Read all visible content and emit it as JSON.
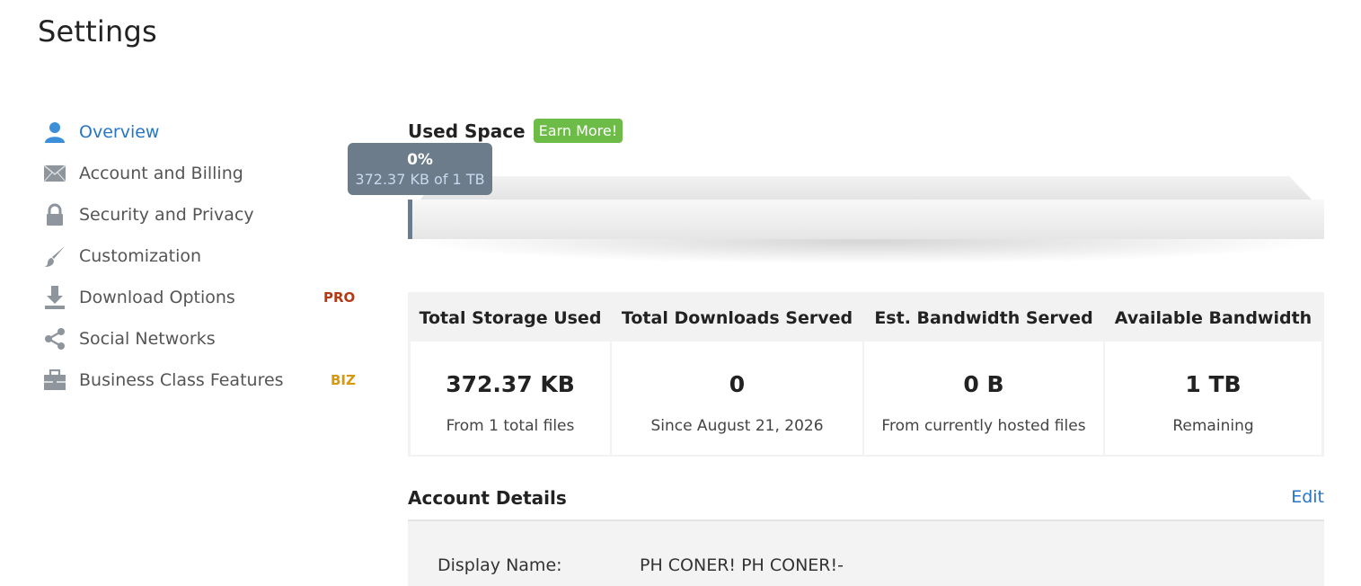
{
  "page": {
    "title": "Settings"
  },
  "sidebar": {
    "items": [
      {
        "label": "Overview",
        "icon": "user-icon",
        "active": true,
        "badge": ""
      },
      {
        "label": "Account and Billing",
        "icon": "envelope-icon",
        "active": false,
        "badge": ""
      },
      {
        "label": "Security and Privacy",
        "icon": "lock-icon",
        "active": false,
        "badge": ""
      },
      {
        "label": "Customization",
        "icon": "brush-icon",
        "active": false,
        "badge": ""
      },
      {
        "label": "Download Options",
        "icon": "download-icon",
        "active": false,
        "badge": "PRO"
      },
      {
        "label": "Social Networks",
        "icon": "share-icon",
        "active": false,
        "badge": ""
      },
      {
        "label": "Business Class Features",
        "icon": "briefcase-icon",
        "active": false,
        "badge": "BIZ"
      }
    ]
  },
  "used_space": {
    "title": "Used Space",
    "earn_more_label": "Earn More!",
    "percent_label": "0%",
    "amount_label": "372.37 KB of 1 TB",
    "fill_fraction": 0.0
  },
  "stats": [
    {
      "header": "Total Storage Used",
      "value": "372.37 KB",
      "sub": "From 1 total files"
    },
    {
      "header": "Total Downloads Served",
      "value": "0",
      "sub": "Since August 21, 2026"
    },
    {
      "header": "Est. Bandwidth Served",
      "value": "0 B",
      "sub": "From currently hosted files"
    },
    {
      "header": "Available Bandwidth",
      "value": "1 TB",
      "sub": "Remaining"
    }
  ],
  "account": {
    "title": "Account Details",
    "edit_label": "Edit",
    "display_name_label": "Display Name:",
    "display_name_value": "PH CONER! PH CONER!-"
  },
  "colors": {
    "accent_blue": "#2676c6",
    "earn_green": "#6cbc47",
    "pro_red": "#b53a14",
    "biz_gold": "#d8980e",
    "tooltip_slate": "#6d7c8a"
  }
}
